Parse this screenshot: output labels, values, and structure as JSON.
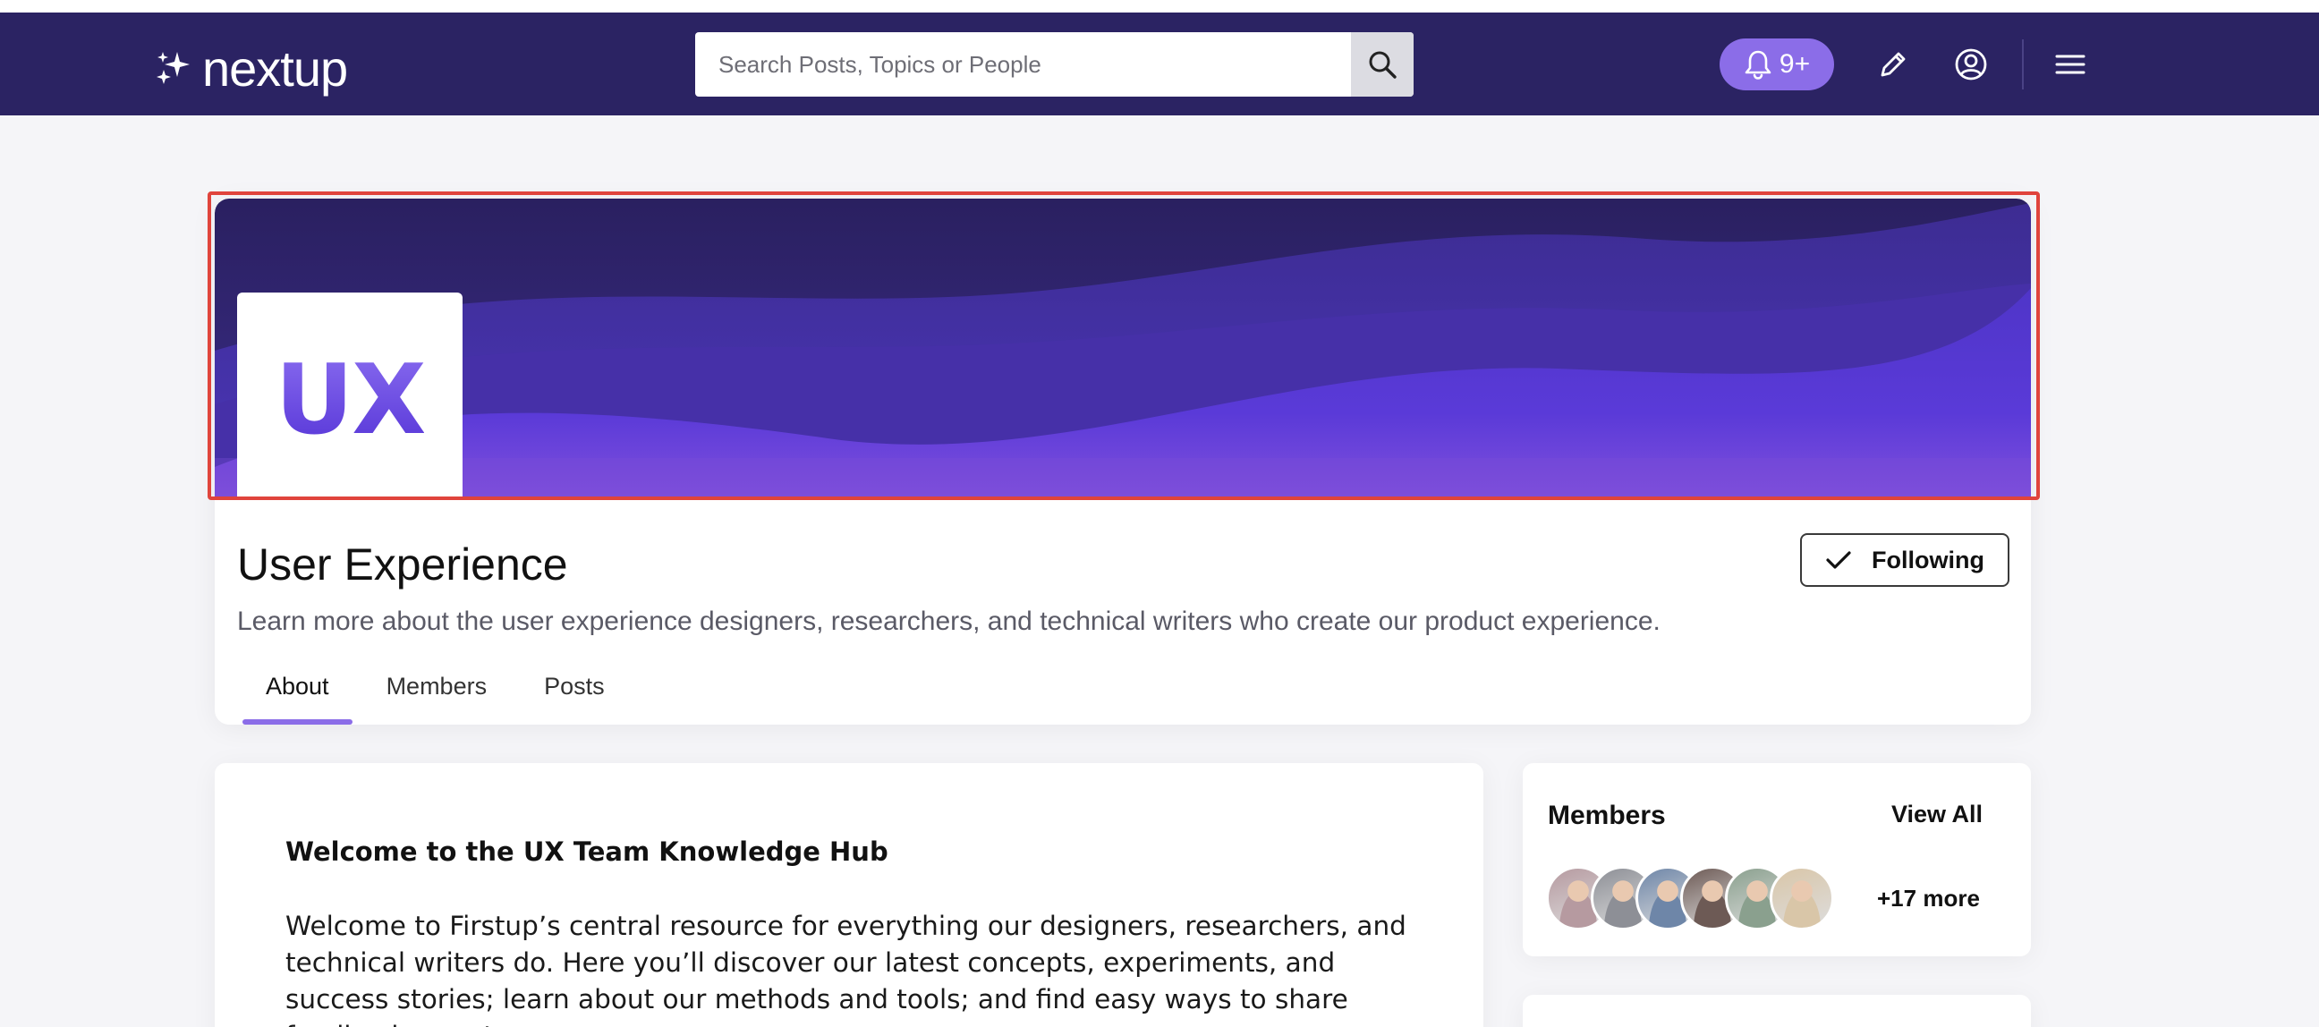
{
  "nav": {
    "logo_text": "nextup",
    "search_placeholder": "Search Posts, Topics or People",
    "notification_badge": "9+"
  },
  "group": {
    "logo_text": "UX",
    "title": "User Experience",
    "description": "Learn more about the user experience designers, researchers, and technical writers who create our product experience.",
    "follow_label": "Following",
    "tabs": [
      "About",
      "Members",
      "Posts"
    ],
    "active_tab": "About"
  },
  "about": {
    "heading": "Welcome to the UX Team Knowledge Hub",
    "body": "Welcome to Firstup’s central resource for everything our designers, researchers, and technical writers do. Here you’ll discover our latest concepts, experiments, and success stories; learn about our methods and tools; and find easy ways to share feedback or get"
  },
  "members": {
    "title": "Members",
    "view_all_label": "View All",
    "more_label": "+17 more",
    "avatar_colors": [
      "#b69aa0",
      "#8d8f96",
      "#6e86a8",
      "#6d5a55",
      "#8aa08e",
      "#d9c6a8"
    ]
  },
  "colors": {
    "nav_bg": "#2b2363",
    "accent": "#8b6de8",
    "banner_dark": "#2a2060",
    "banner_light": "#5a35d6"
  }
}
